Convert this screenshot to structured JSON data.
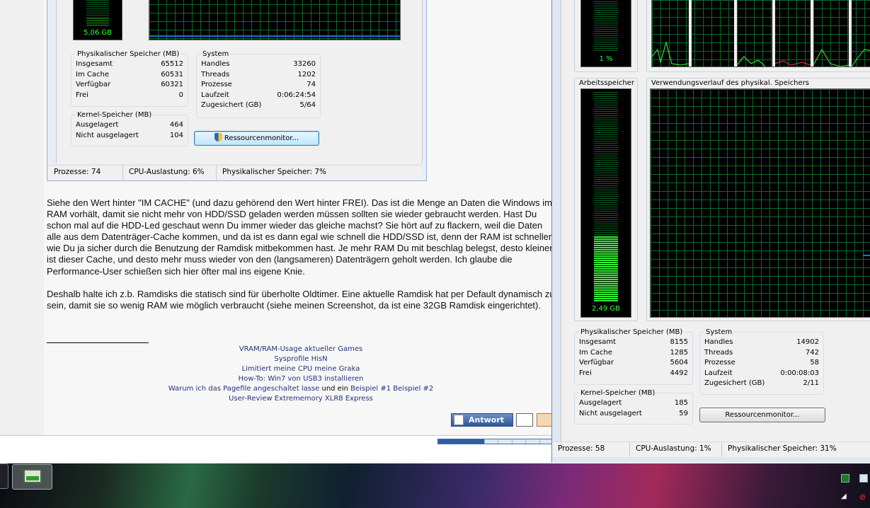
{
  "task_manager_left": {
    "cpu_meter_label": "5,06 GB",
    "physical_memory": {
      "title": "Physikalischer Speicher (MB)",
      "rows": [
        {
          "label": "Insgesamt",
          "value": "65512"
        },
        {
          "label": "Im Cache",
          "value": "60531"
        },
        {
          "label": "Verfügbar",
          "value": "60321"
        },
        {
          "label": "Frei",
          "value": "0"
        }
      ]
    },
    "system": {
      "title": "System",
      "rows": [
        {
          "label": "Handles",
          "value": "33260"
        },
        {
          "label": "Threads",
          "value": "1202"
        },
        {
          "label": "Prozesse",
          "value": "74"
        },
        {
          "label": "Laufzeit",
          "value": "0:06:24:54"
        },
        {
          "label": "Zugesichert (GB)",
          "value": "5/64"
        }
      ]
    },
    "kernel_memory": {
      "title": "Kernel-Speicher (MB)",
      "rows": [
        {
          "label": "Ausgelagert",
          "value": "464"
        },
        {
          "label": "Nicht ausgelagert",
          "value": "104"
        }
      ]
    },
    "resource_button": "Ressourcenmonitor...",
    "status": {
      "processes": "Prozesse: 74",
      "cpu": "CPU-Auslastung: 6%",
      "memory": "Physikalischer Speicher: 7%"
    }
  },
  "post": {
    "paragraph1": "Siehe den Wert hinter \"IM CACHE\" (und dazu gehörend den Wert hinter FREI). Das ist die Menge an Daten die Windows im RAM vorhält, damit sie nicht mehr von HDD/SSD geladen werden müssen sollten sie wieder gebraucht werden. Hast Du schon mal auf die HDD-Led geschaut wenn Du immer wieder das gleiche machst? Sie hört auf zu flackern, weil die Daten alle aus dem Datenträger-Cache kommen, und da ist es dann egal wie schnell die HDD/SSD ist, denn der RAM ist schneller, wie Du ja sicher durch die Benutzung der Ramdisk mitbekommen hast. Je mehr RAM Du mit beschlag belegst, desto kleiner ist dieser Cache, und desto mehr muss wieder von den (langsameren) Datenträgern geholt werden. Ich glaube die Performance-User schießen sich hier öfter mal ins eigene Knie.",
    "paragraph2": "Deshalb halte ich z.b. Ramdisks die statisch sind für überholte Oldtimer. Eine aktuelle Ramdisk hat per Default dynamisch zu sein, damit sie so wenig RAM wie möglich verbraucht (siehe meinen Screenshot, da ist eine 32GB Ramdisk eingerichtet)."
  },
  "signature": {
    "link1": "VRAM/RAM-Usage aktueller Games",
    "link2": "Sysprofile HisN",
    "link3": "Limitiert meine CPU meine Graka",
    "link4": "How-To: Win7 von USB3 installieren",
    "link5a": "Warum ich das Pagefile angeschaltet lasse",
    "link5_plain": " und ein ",
    "link5b": "Beispiel #1",
    "link5c": "Beispiel #2",
    "link6": "User-Review Extrememory XLR8 Express"
  },
  "buttons": {
    "reply": "Antwort"
  },
  "task_manager_right": {
    "cpu_meter_label": "1 %",
    "memory_panel_title": "Arbeitsspeicher",
    "memory_meter_label": "2,49 GB",
    "memory_meter_fill": 0.31,
    "history_panel_title": "Verwendungsverlauf des physikal. Speichers",
    "physical_memory": {
      "title": "Physikalischer Speicher (MB)",
      "rows": [
        {
          "label": "Insgesamt",
          "value": "8155"
        },
        {
          "label": "Im Cache",
          "value": "1285"
        },
        {
          "label": "Verfügbar",
          "value": "5604"
        },
        {
          "label": "Frei",
          "value": "4492"
        }
      ]
    },
    "system": {
      "title": "System",
      "rows": [
        {
          "label": "Handles",
          "value": "14902"
        },
        {
          "label": "Threads",
          "value": "742"
        },
        {
          "label": "Prozesse",
          "value": "58"
        },
        {
          "label": "Laufzeit",
          "value": "0:00:08:03"
        },
        {
          "label": "Zugesichert (GB)",
          "value": "2/11"
        }
      ]
    },
    "kernel_memory": {
      "title": "Kernel-Speicher (MB)",
      "rows": [
        {
          "label": "Ausgelagert",
          "value": "185"
        },
        {
          "label": "Nicht ausgelagert",
          "value": "59"
        }
      ]
    },
    "resource_button": "Ressourcenmonitor...",
    "status": {
      "processes": "Prozesse: 58",
      "cpu": "CPU-Auslastung: 1%",
      "memory": "Physikalischer Speicher: 31%"
    }
  },
  "colors": {
    "graph_grid": "#0b6b2b",
    "meter_green": "#33f033",
    "link_blue": "#22337a"
  }
}
